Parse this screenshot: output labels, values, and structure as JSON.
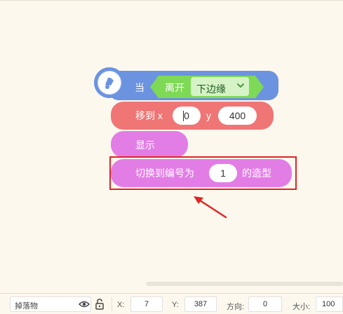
{
  "hat": {
    "label": "当",
    "edge_label": "离开",
    "edge_value": "下边缘",
    "icon": "sprite-bell-icon"
  },
  "move": {
    "label": "移到 x",
    "x_value": "0",
    "y_label": "y",
    "y_value": "400"
  },
  "show": {
    "label": "显示"
  },
  "switch_costume": {
    "label_before": "切换到编号为",
    "value": "1",
    "label_after": "的造型"
  },
  "bottom": {
    "sprite_name": "掉落物",
    "x_label": "X:",
    "x_value": "7",
    "y_label": "Y:",
    "y_value": "387",
    "direction_label": "方向:",
    "direction_value": "0",
    "size_label": "大小:",
    "size_value": "100"
  },
  "colors": {
    "event": "#6b93e0",
    "motion": "#f07575",
    "looks": "#e37de6",
    "dropdown_green": "#7ed957",
    "highlight": "#e02424"
  }
}
